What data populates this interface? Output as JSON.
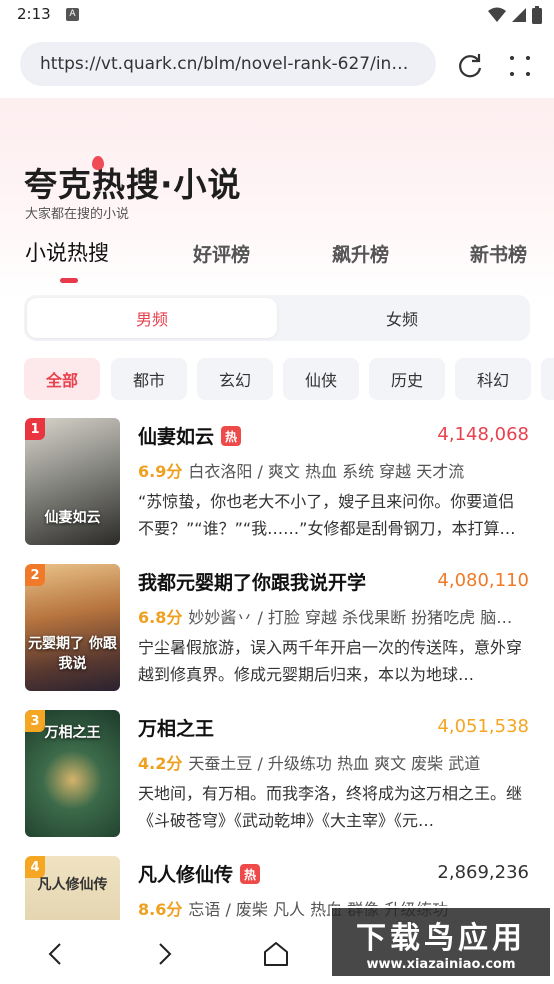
{
  "status_bar": {
    "time": "2:13",
    "notification_letter": "A"
  },
  "browser": {
    "url": "https://vt.quark.cn/blm/novel-rank-627/index.html",
    "reload_icon": "reload-icon",
    "more_icon": "more-dots-icon"
  },
  "header": {
    "title": "夸克热搜·小说",
    "subtitle": "大家都在搜的小说"
  },
  "tabs": [
    {
      "label": "小说热搜",
      "active": true
    },
    {
      "label": "好评榜",
      "active": false
    },
    {
      "label": "飙升榜",
      "active": false
    },
    {
      "label": "新书榜",
      "active": false
    }
  ],
  "gender": {
    "male": "男频",
    "female": "女频",
    "selected": "男频"
  },
  "categories": [
    "全部",
    "都市",
    "玄幻",
    "仙侠",
    "历史",
    "科幻"
  ],
  "books": [
    {
      "rank": "1",
      "title": "仙妻如云",
      "hot": "热",
      "count": "4,148,068",
      "score": "6.9分",
      "meta": "白衣洛阳 / 爽文 热血 系统 穿越 天才流",
      "desc": "“苏惊蛰，你也老大不小了，嫂子且来问你。你要道侣不要？”“谁？”“我……”女修都是刮骨钢刀，本打算…",
      "cover_text": "仙妻如云"
    },
    {
      "rank": "2",
      "title": "我都元婴期了你跟我说开学",
      "hot": "",
      "count": "4,080,110",
      "score": "6.8分",
      "meta": "妙妙酱丷 / 打脸 穿越 杀伐果断 扮猪吃虎 脑…",
      "desc": "宁尘暑假旅游，误入两千年开启一次的传送阵，意外穿越到修真界。修成元婴期后归来，本以为地球…",
      "cover_text": "元婴期了 你跟我说"
    },
    {
      "rank": "3",
      "title": "万相之王",
      "hot": "",
      "count": "4,051,538",
      "score": "4.2分",
      "meta": "天蚕土豆 / 升级练功 热血 爽文 废柴 武道",
      "desc": "天地间，有万相。而我李洛，终将成为这万相之王。继《斗破苍穹》《武动乾坤》《大主宰》《元…",
      "cover_text": "万相之王"
    },
    {
      "rank": "4",
      "title": "凡人修仙传",
      "hot": "热",
      "count": "2,869,236",
      "score": "8.6分",
      "meta": "忘语 / 废柴 凡人 热血 群像 升级练功",
      "desc": "",
      "cover_text": "凡人修仙传"
    }
  ],
  "bottom_nav": {
    "back_icon": "back-chevron-icon",
    "forward_icon": "forward-chevron-icon",
    "home_icon": "home-icon"
  },
  "watermark": {
    "main": "下载鸟应用",
    "sub": "www.xiazainiao.com"
  },
  "colors": {
    "accent": "#e8424f",
    "count_top": "#e8424f",
    "count_normal": "#333333",
    "score": "#f0a020",
    "rank1": "#e8353f",
    "rank2": "#f07a2a",
    "rank3": "#f5a623"
  }
}
